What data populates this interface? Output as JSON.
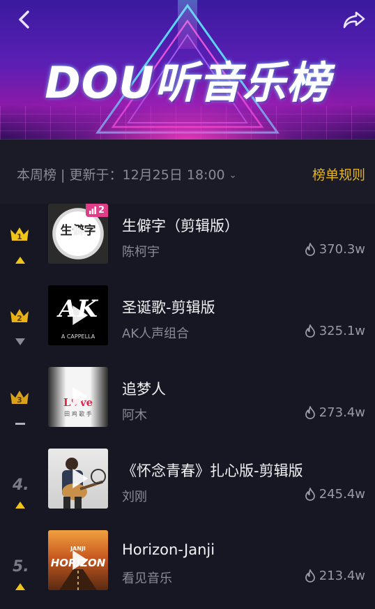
{
  "header": {
    "title": "DOU听音乐榜",
    "back_icon": "chevron-left-icon",
    "share_icon": "share-arrow-icon",
    "colors": {
      "top": "#3a1a9e",
      "mid": "#8a1aa8",
      "neon": "#ff3cc8"
    }
  },
  "info": {
    "update_text": "本周榜 | 更新于：12月25日 18:00",
    "rules_label": "榜单规则",
    "rules_color": "#e6b51f"
  },
  "songs": [
    {
      "rank": "1",
      "rank_style": "crown",
      "crown_color": "#f0c419",
      "trend": "up",
      "title": "生僻字（剪辑版）",
      "artist": "陈柯宇",
      "heat": "370.3w",
      "badge": "2",
      "cover_style": "shengpizi",
      "cover_text": "生僻字"
    },
    {
      "rank": "2",
      "rank_style": "crown",
      "crown_color": "#e8b214",
      "trend": "down",
      "title": "圣诞歌-剪辑版",
      "artist": "AK人声组合",
      "heat": "325.1w",
      "cover_style": "ak",
      "cover_text": "AK",
      "cover_sub": "A CAPPELLA"
    },
    {
      "rank": "3",
      "rank_style": "crown",
      "crown_color": "#d9a21a",
      "trend": "flat",
      "title": "追梦人",
      "artist": "阿木",
      "heat": "273.4w",
      "cover_style": "zhuimeng",
      "cover_text": "L♥ve",
      "cover_sub": "田 鸡 歌 手"
    },
    {
      "rank": "4.",
      "rank_style": "number",
      "trend": "up",
      "title": "《怀念青春》扎心版-剪辑版",
      "artist": "刘刚",
      "heat": "245.4w",
      "cover_style": "guitar"
    },
    {
      "rank": "5.",
      "rank_style": "number",
      "trend": "up",
      "title": "Horizon-Janji",
      "artist": "看见音乐",
      "heat": "213.4w",
      "cover_style": "horizon",
      "cover_text": "HORIZON",
      "cover_sub": "JANJI"
    }
  ]
}
